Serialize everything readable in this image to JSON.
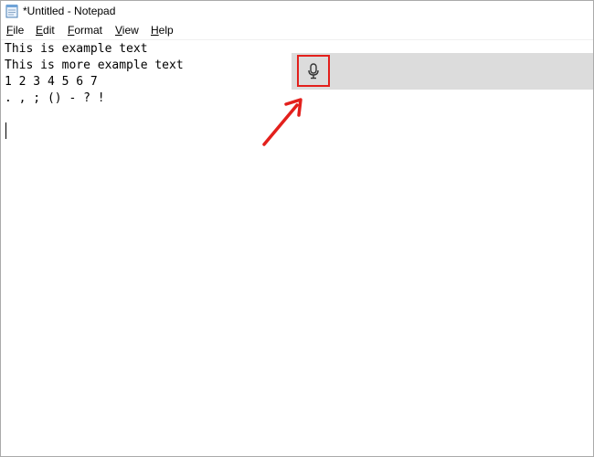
{
  "window": {
    "title": "*Untitled - Notepad"
  },
  "menu": {
    "items": [
      {
        "accel": "F",
        "rest": "ile"
      },
      {
        "accel": "E",
        "rest": "dit"
      },
      {
        "accel": "F",
        "rest": "ormat"
      },
      {
        "accel": "V",
        "rest": "iew"
      },
      {
        "accel": "H",
        "rest": "elp"
      }
    ]
  },
  "editor": {
    "lines": [
      "This is example text",
      "This is more example text",
      "1 2 3 4 5 6 7",
      ". , ; () - ? !"
    ]
  },
  "dictation": {
    "icon": "microphone-icon"
  },
  "colors": {
    "highlight": "#e3201c",
    "dictation_bar": "#dcdcdc"
  }
}
